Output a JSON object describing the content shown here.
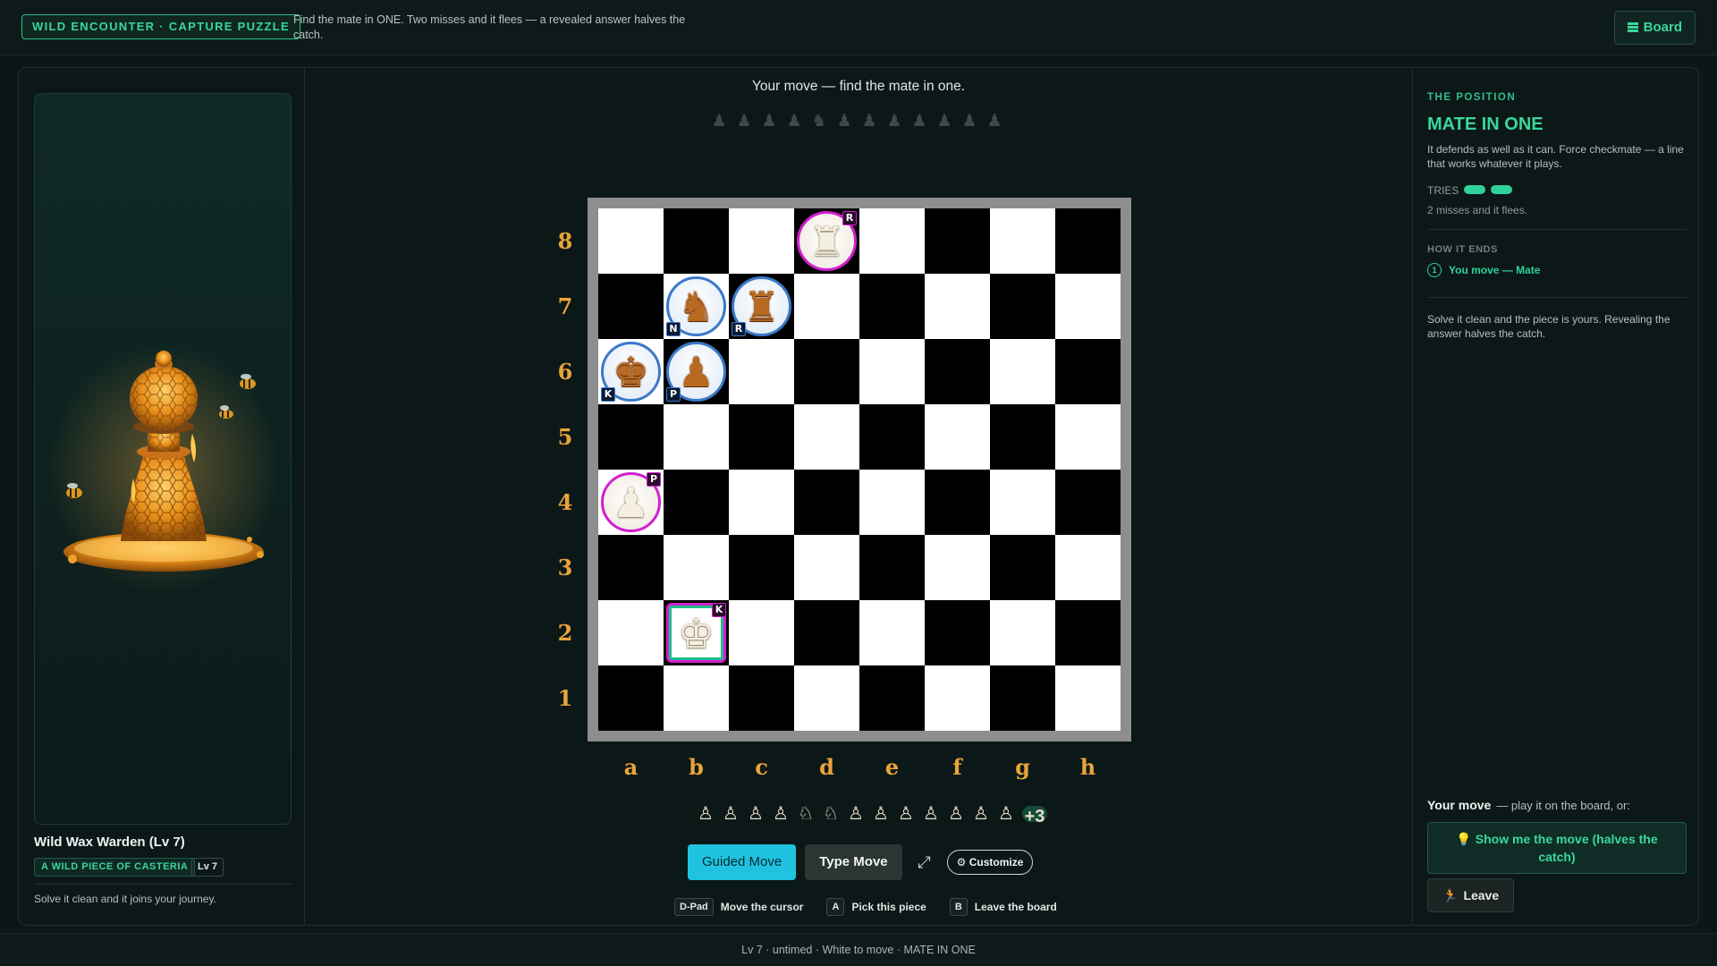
{
  "header": {
    "mode_badge": "WILD ENCOUNTER · CAPTURE PUZZLE",
    "description": "Find the mate in ONE. Two misses and it flees — a revealed answer halves the catch.",
    "board_button": "Board"
  },
  "wild": {
    "name": "Wild Wax Warden (Lv 7)",
    "tag": "A WILD PIECE OF CASTERIA",
    "level": "Lv 7",
    "description": "Solve it clean and it joins your journey."
  },
  "center": {
    "prompt": "Your move — find the mate in one.",
    "top_tray": [
      "♟",
      "♟",
      "♟",
      "♟",
      "♞",
      "♟",
      "♟",
      "♟",
      "♟",
      "♟",
      "♟",
      "♟"
    ],
    "bottom_tray": [
      "♙",
      "♙",
      "♙",
      "♙",
      "♘",
      "♘",
      "♙",
      "♙",
      "♙",
      "♙",
      "♙",
      "♙",
      "♙"
    ],
    "bottom_tray_more": "+3",
    "ranks": [
      "8",
      "7",
      "6",
      "5",
      "4",
      "3",
      "2",
      "1"
    ],
    "files": [
      "a",
      "b",
      "c",
      "d",
      "e",
      "f",
      "g",
      "h"
    ],
    "controls": {
      "guided": "Guided Move",
      "type": "Type Move",
      "expand": "⤢",
      "customize": "⚙ Customize"
    },
    "hints": [
      {
        "key": "D-Pad",
        "label": "Move the cursor"
      },
      {
        "key": "A",
        "label": "Pick this piece"
      },
      {
        "key": "B",
        "label": "Leave the board"
      }
    ]
  },
  "board": {
    "pieces": [
      {
        "square": "d8",
        "color": "white",
        "glyph": "♜",
        "letter": "R"
      },
      {
        "square": "b7",
        "color": "black",
        "glyph": "♞",
        "letter": "N"
      },
      {
        "square": "c7",
        "color": "black",
        "glyph": "♜",
        "letter": "R"
      },
      {
        "square": "a6",
        "color": "black",
        "glyph": "♚",
        "letter": "K"
      },
      {
        "square": "b6",
        "color": "black",
        "glyph": "♟",
        "letter": "P"
      },
      {
        "square": "a4",
        "color": "white",
        "glyph": "♟",
        "letter": "P"
      },
      {
        "square": "b2",
        "color": "white",
        "glyph": "♚",
        "letter": "K",
        "selected": true
      }
    ]
  },
  "position_panel": {
    "eyebrow": "THE POSITION",
    "title": "MATE IN ONE",
    "description": "It defends as well as it can. Force checkmate — a line that works whatever it plays.",
    "tries_label": "TRIES",
    "tries_remaining": 2,
    "misses_text": "2 misses and it flees.",
    "how_it_ends_label": "HOW IT ENDS",
    "steps": [
      {
        "num": "1",
        "label": "You move — Mate"
      }
    ],
    "note": "Solve it clean and the piece is yours. Revealing the answer halves the catch.",
    "your_move_label": "Your move",
    "your_move_sub": "— play it on the board, or:",
    "show_button": "Show me the move (halves the catch)",
    "leave_button": "Leave"
  },
  "footer": {
    "status": "Lv 7 · untimed · White to move · MATE IN ONE"
  },
  "colors": {
    "accent": "#3ad79b",
    "white_ring": "#d21fcf",
    "black_ring": "#3b78c8",
    "coord": "#e9a43a",
    "guided_button": "#1fc3e0"
  }
}
